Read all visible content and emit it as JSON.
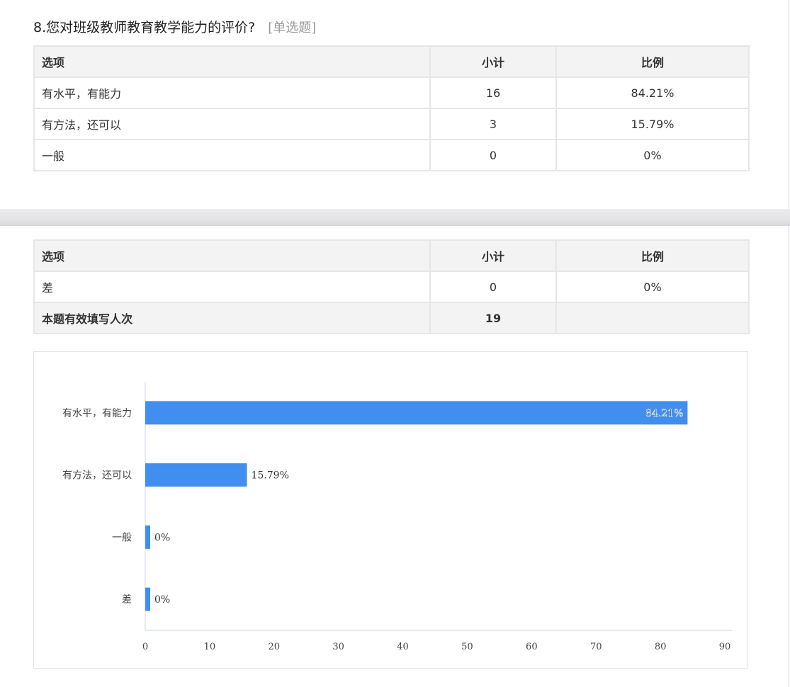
{
  "question": {
    "title": "8.您对班级教师教育教学能力的评价?",
    "type": "[单选题]"
  },
  "table": {
    "headers": [
      "选项",
      "小计",
      "比例"
    ],
    "rows_top": [
      {
        "option": "有水平，有能力",
        "count": "16",
        "ratio": "84.21%"
      },
      {
        "option": "有方法，还可以",
        "count": "3",
        "ratio": "15.79%"
      },
      {
        "option": "一般",
        "count": "0",
        "ratio": "0%"
      }
    ],
    "rows_bottom": [
      {
        "option": "差",
        "count": "0",
        "ratio": "0%"
      }
    ],
    "summary": {
      "label": "本题有效填写人次",
      "count": "19",
      "ratio": ""
    }
  },
  "chart_data": {
    "type": "bar",
    "orientation": "horizontal",
    "categories": [
      "有水平，有能力",
      "有方法，还可以",
      "一般",
      "差"
    ],
    "values": [
      84.21,
      15.79,
      0,
      0
    ],
    "labels": [
      "84.21%",
      "15.79%",
      "0%",
      "0%"
    ],
    "xlim": [
      0,
      90
    ],
    "xticks": [
      0,
      10,
      20,
      30,
      40,
      50,
      60,
      70,
      80,
      90
    ],
    "bar_color": "#3f8ef0",
    "title": "",
    "xlabel": "",
    "ylabel": ""
  }
}
